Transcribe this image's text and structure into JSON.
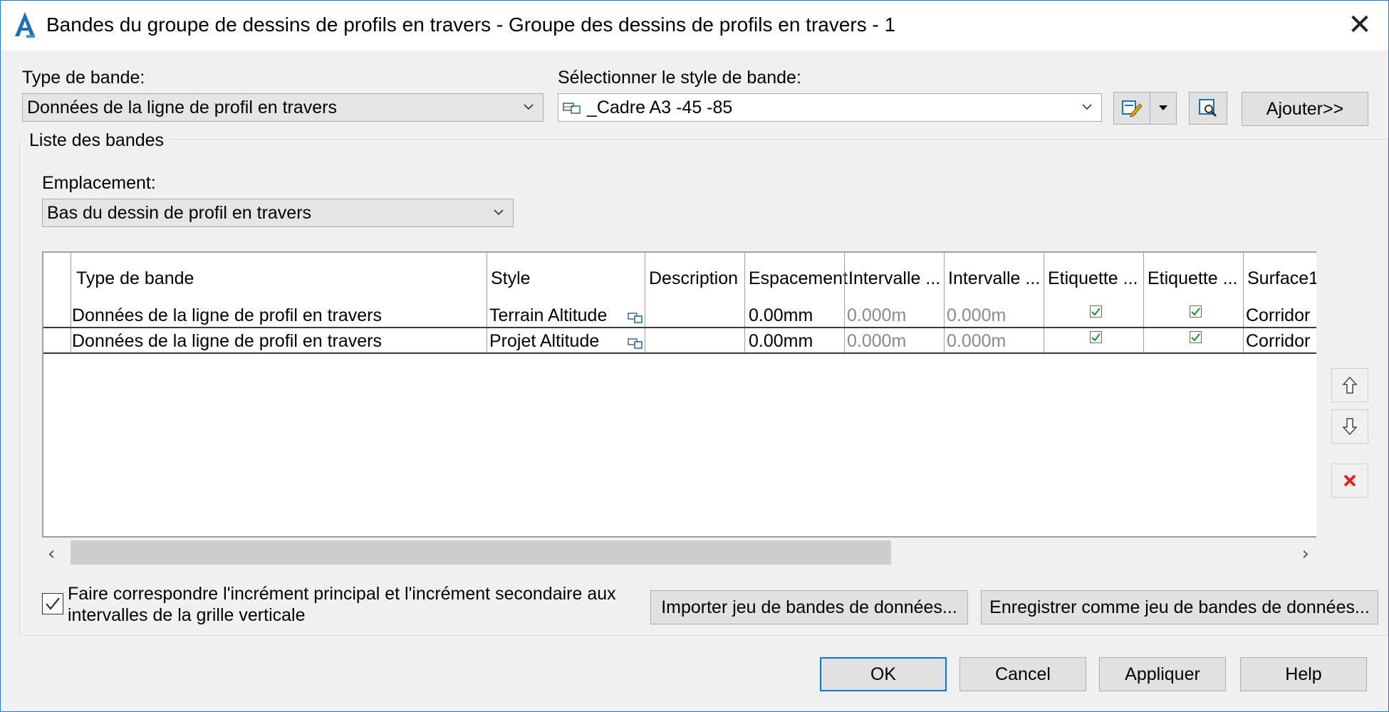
{
  "window": {
    "title": "Bandes du groupe de dessins de profils en travers - Groupe des dessins de profils en travers - 1",
    "close_label": "✕",
    "app_icon_letter": "A"
  },
  "band_type": {
    "label": "Type de bande:",
    "value": "Données de la ligne de profil en travers"
  },
  "band_style": {
    "label": "Sélectionner le style de bande:",
    "value": "_Cadre A3 -45 -85"
  },
  "add_button": "Ajouter>>",
  "band_list": {
    "title": "Liste des bandes",
    "location_label": "Emplacement:",
    "location_value": "Bas du dessin de profil en travers",
    "columns": [
      "Type de bande",
      "Style",
      "Description",
      "Espacement",
      "Intervalle ...",
      "Intervalle ...",
      "Etiquette ...",
      "Etiquette ...",
      "Surface1"
    ],
    "rows": [
      {
        "type": "Données de la ligne de profil en travers",
        "style": "Terrain Altitude",
        "description": "",
        "spacing": "0.00mm",
        "interval1": "0.000m",
        "interval2": "0.000m",
        "label1_checked": true,
        "label2_checked": true,
        "surface": "Corridor"
      },
      {
        "type": "Données de la ligne de profil en travers",
        "style": "Projet Altitude",
        "description": "",
        "spacing": "0.00mm",
        "interval1": "0.000m",
        "interval2": "0.000m",
        "label1_checked": true,
        "label2_checked": true,
        "surface": "Corridor"
      }
    ]
  },
  "match_increment": {
    "label_line1": "Faire correspondre l'incrément principal et l'incrément secondaire aux",
    "label_line2": "intervalles de la grille verticale",
    "checked": true
  },
  "import_button": "Importer jeu de bandes de données...",
  "save_button": "Enregistrer comme jeu de bandes de données...",
  "footer": {
    "ok": "OK",
    "cancel": "Cancel",
    "apply": "Appliquer",
    "help": "Help"
  },
  "colors": {
    "accent": "#0078d7",
    "title_border": "#1b78d3",
    "delete": "#e02424",
    "check": "#1a8f2a"
  }
}
